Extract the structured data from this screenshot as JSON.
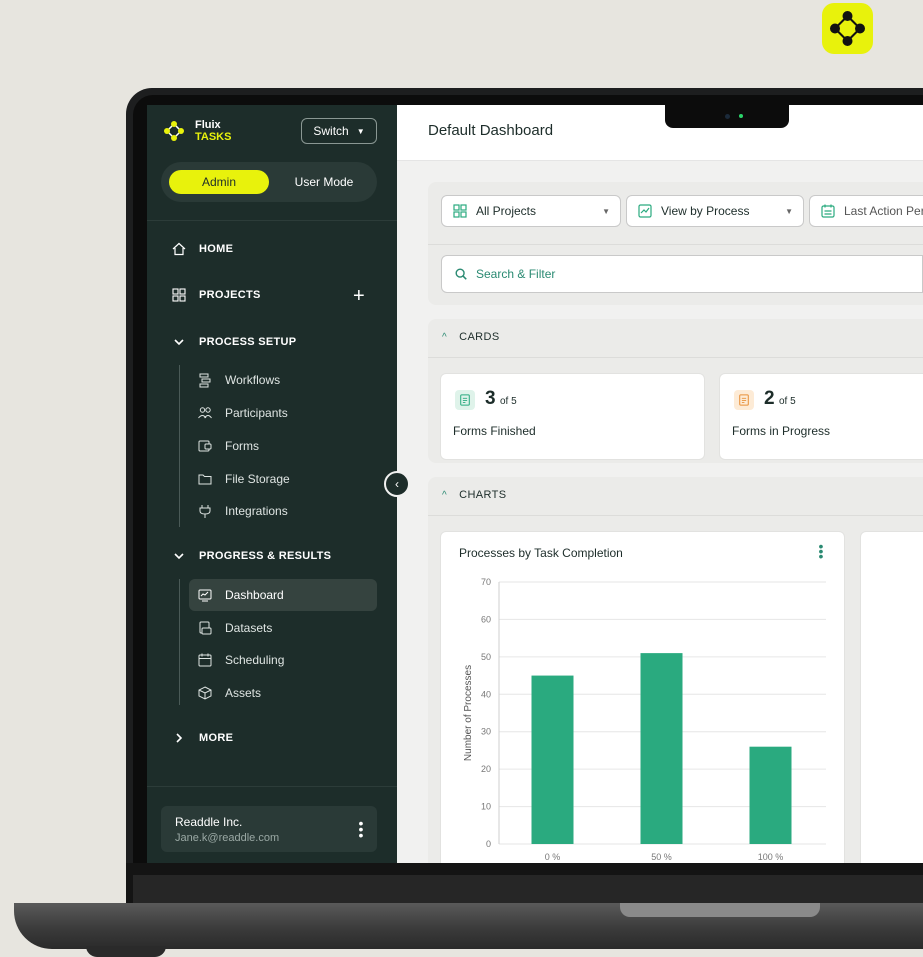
{
  "window": {
    "page_title": "Default Dashboard"
  },
  "brand": {
    "name_line1": "Fluix",
    "name_line2": "TASKS",
    "switch_label": "Switch",
    "accent_color": "#e8f20c",
    "sidebar_color": "#1d2d2a",
    "primary_color": "#2aaa7f"
  },
  "mode": {
    "admin_label": "Admin",
    "user_label": "User Mode",
    "selected": "Admin"
  },
  "sidebar": {
    "home": {
      "label": "HOME",
      "icon": "home-icon"
    },
    "projects": {
      "label": "PROJECTS",
      "icon": "grid-icon",
      "add_label": "+"
    },
    "process_setup": {
      "label": "PROCESS SETUP",
      "items": [
        {
          "label": "Workflows",
          "icon": "workflow-icon"
        },
        {
          "label": "Participants",
          "icon": "users-icon"
        },
        {
          "label": "Forms",
          "icon": "form-icon"
        },
        {
          "label": "File Storage",
          "icon": "folder-icon"
        },
        {
          "label": "Integrations",
          "icon": "plug-icon"
        }
      ]
    },
    "progress_results": {
      "label": "PROGRESS & RESULTS",
      "items": [
        {
          "label": "Dashboard",
          "icon": "dashboard-icon",
          "active": true
        },
        {
          "label": "Datasets",
          "icon": "dataset-icon"
        },
        {
          "label": "Scheduling",
          "icon": "calendar-icon"
        },
        {
          "label": "Assets",
          "icon": "box-icon"
        }
      ]
    },
    "more": {
      "label": "MORE"
    },
    "account": {
      "name": "Readdle Inc.",
      "email": "Jane.k@readdle.com"
    }
  },
  "filters": {
    "projects": "All Projects",
    "view": "View by Process",
    "period": "Last Action Per",
    "search_placeholder": "Search & Filter"
  },
  "cards_section": {
    "label": "CARDS",
    "cards": [
      {
        "value": "3",
        "suffix": "of 5",
        "label": "Forms Finished",
        "color": "#2aaa7f"
      },
      {
        "value": "2",
        "suffix": "of 5",
        "label": "Forms in Progress",
        "color": "#e8913a"
      }
    ]
  },
  "charts_section": {
    "label": "CHARTS"
  },
  "chart_data": {
    "type": "bar",
    "title": "Processes by Task Completion",
    "categories": [
      "0 %",
      "50 %",
      "100 %"
    ],
    "values": [
      45,
      51,
      26
    ],
    "xlabel": "",
    "ylabel": "Number of Processes",
    "ylim": [
      0,
      70
    ],
    "yticks": [
      0,
      10,
      20,
      30,
      40,
      50,
      60,
      70
    ],
    "grid": true,
    "bar_color": "#2aaa7f"
  }
}
